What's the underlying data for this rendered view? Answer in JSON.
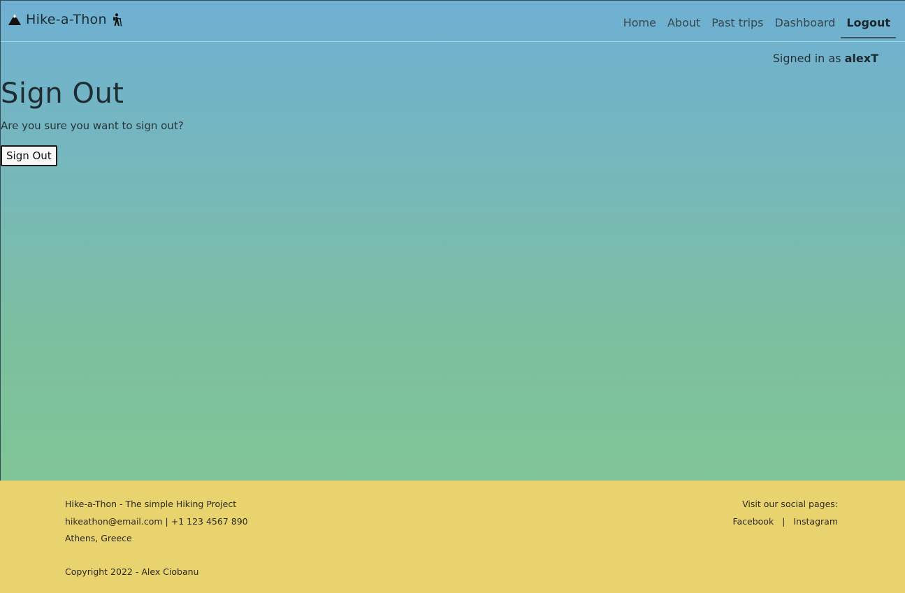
{
  "navbar": {
    "brand": "Hike-a-Thon",
    "links": [
      {
        "label": "Home"
      },
      {
        "label": "About"
      },
      {
        "label": "Past trips"
      },
      {
        "label": "Dashboard"
      },
      {
        "label": "Logout",
        "active": true
      }
    ]
  },
  "auth": {
    "prefix": "Signed in as",
    "username": "alexT"
  },
  "main": {
    "title": "Sign Out",
    "question": "Are you sure you want to sign out?",
    "button_label": "Sign Out"
  },
  "footer": {
    "tagline": "Hike-a-Thon - The simple Hiking Project",
    "contact": "hikeathon@email.com | +1 123 4567 890",
    "location": "Athens, Greece",
    "copyright": "Copyright 2022 - Alex Ciobanu",
    "social_heading": "Visit our social pages:",
    "facebook": "Facebook",
    "separator": "|",
    "instagram": "Instagram"
  },
  "colors": {
    "gradient_top": "#6fb0d3",
    "gradient_bottom": "#80c597",
    "footer_bg": "#e9d36f"
  },
  "icons": {
    "brand_left": "mountain-icon",
    "brand_right": "hiker-icon"
  }
}
